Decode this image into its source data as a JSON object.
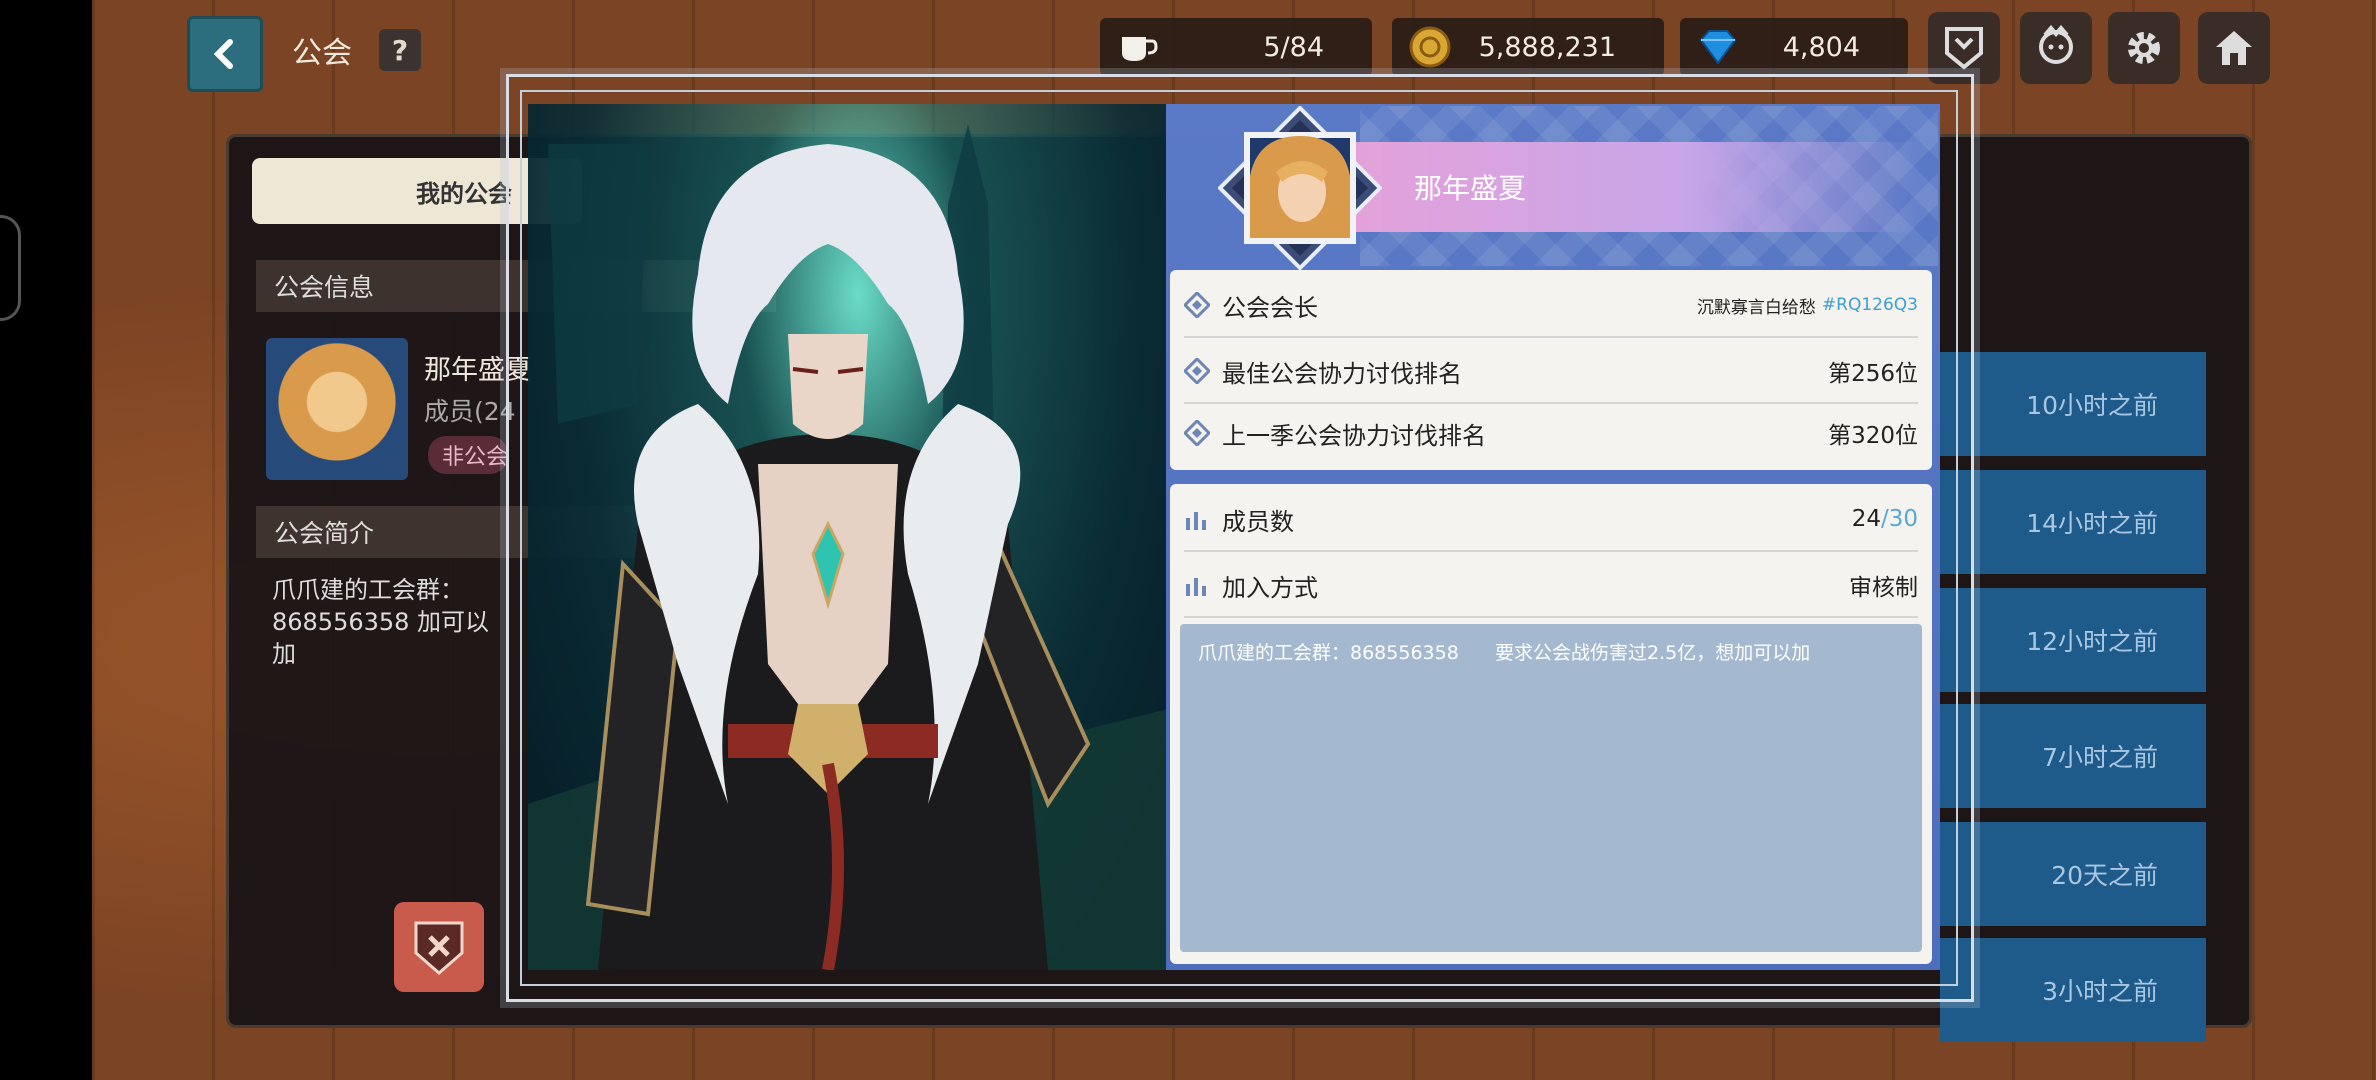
{
  "topbar": {
    "title": "公会",
    "help_label": "?",
    "stamina": "5/84",
    "gold": "5,888,231",
    "gems": "4,804"
  },
  "background": {
    "my_guild_tab": "我的公会",
    "guild_info_heading": "公会信息",
    "guild_name": "那年盛夏",
    "members": "成员(24",
    "badge": "非公会",
    "intro_heading": "公会简介",
    "intro_text": "爪爪建的工会群：868556358 加可以加",
    "times": [
      "10小时之前",
      "14小时之前",
      "12小时之前",
      "7小时之前",
      "20天之前",
      "3小时之前"
    ]
  },
  "popup": {
    "guild_name": "那年盛夏",
    "leader_label": "公会会长",
    "leader_value": "沉默寡言白给愁",
    "leader_tag": "#RQ126Q3",
    "best_rank_label": "最佳公会协力讨伐排名",
    "best_rank_value": "第256位",
    "last_rank_label": "上一季公会协力讨伐排名",
    "last_rank_value": "第320位",
    "members_label": "成员数",
    "members_current": "24",
    "members_max": "/30",
    "join_label": "加入方式",
    "join_value": "审核制",
    "description": "爪爪建的工会群：868556358      要求公会战伤害过2.5亿，想加可以加"
  },
  "colors": {
    "accent_blue": "#4e6dbd",
    "banner_pink": "#e5a1d9",
    "tag_blue": "#3f9fcf"
  },
  "icons": [
    "back-arrow-icon",
    "coffee-icon",
    "gold-coin-icon",
    "gem-icon",
    "guild-crest-icon",
    "character-icon",
    "gear-icon",
    "home-icon",
    "diamond-bullet-icon",
    "bar-chart-icon",
    "leave-guild-icon"
  ]
}
